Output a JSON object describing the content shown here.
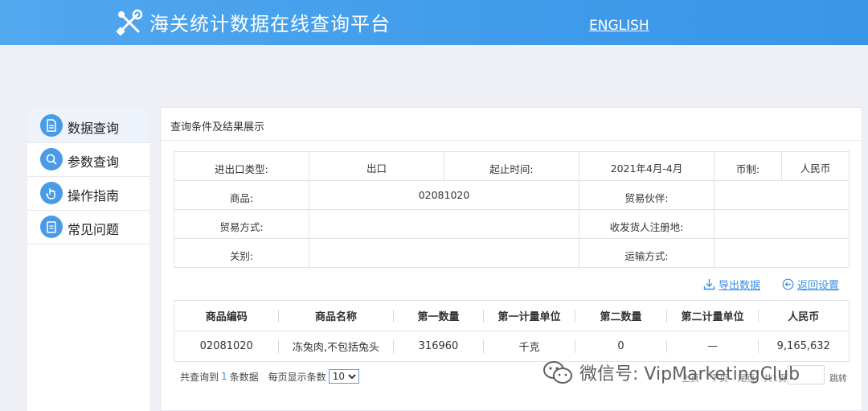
{
  "header": {
    "title": "海关统计数据在线查询平台",
    "lang_link": "ENGLISH",
    "logo_icon": "tools-icon"
  },
  "sidebar": {
    "items": [
      {
        "label": "数据查询",
        "icon": "document-icon",
        "active": true
      },
      {
        "label": "参数查询",
        "icon": "search-icon",
        "active": false
      },
      {
        "label": "操作指南",
        "icon": "hand-icon",
        "active": false
      },
      {
        "label": "常见问题",
        "icon": "clipboard-icon",
        "active": false
      }
    ]
  },
  "panel": {
    "title": "查询条件及结果展示"
  },
  "conditions": {
    "ie_type_label": "进出口类型:",
    "ie_type_value": "出口",
    "period_label": "起止时间:",
    "period_value": "2021年4月-4月",
    "currency_label": "币制:",
    "currency_value": "人民币",
    "goods_label": "商品:",
    "goods_value": "02081020",
    "partner_label": "贸易伙伴:",
    "partner_value": "",
    "trade_mode_label": "贸易方式:",
    "trade_mode_value": "",
    "consignee_label": "收发货人注册地:",
    "consignee_value": "",
    "customs_label": "关别:",
    "customs_value": "",
    "transport_label": "运输方式:",
    "transport_value": ""
  },
  "actions": {
    "export": "导出数据",
    "back": "返回设置"
  },
  "result": {
    "headers": [
      "商品编码",
      "商品名称",
      "第一数量",
      "第一计量单位",
      "第二数量",
      "第二计量单位",
      "人民币"
    ],
    "rows": [
      [
        "02081020",
        "冻兔肉,不包括兔头",
        "316960",
        "千克",
        "0",
        "—",
        "9,165,632"
      ]
    ]
  },
  "pager": {
    "total_prefix": "共查询到",
    "total_count": "1",
    "total_suffix": "条数据",
    "page_size_label": "每页显示条数",
    "page_size_value": "10",
    "goto_label": "跳转",
    "faint_text": [
      "上页",
      "下页",
      "尾页",
      "共1页"
    ]
  },
  "watermark": {
    "text": "微信号: VipMarketingClub"
  },
  "colors": {
    "header_blue": "#3f9bea",
    "link_blue": "#3a8ee6",
    "sidebar_icon": "#4a9be6"
  }
}
